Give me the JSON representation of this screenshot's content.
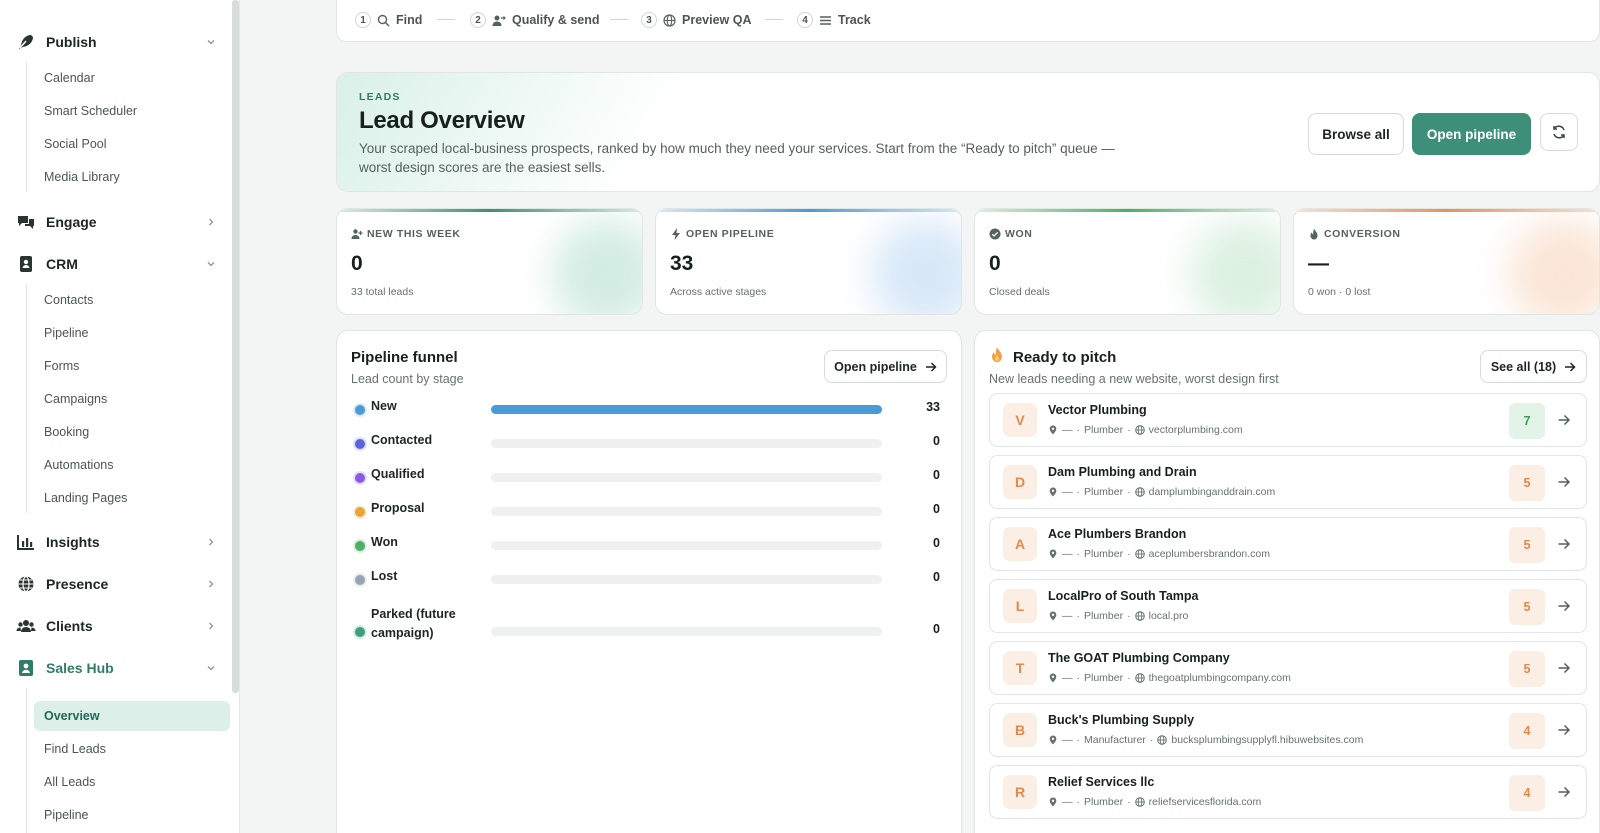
{
  "sidebar": {
    "groups": [
      {
        "label": "Publish",
        "icon": "feather-pen-icon",
        "expanded": true
      },
      {
        "label": "Engage",
        "icon": "chat-bubbles-icon",
        "expanded": false
      },
      {
        "label": "CRM",
        "icon": "contact-book-icon",
        "expanded": true
      },
      {
        "label": "Insights",
        "icon": "bar-chart-icon",
        "expanded": false
      },
      {
        "label": "Presence",
        "icon": "globe-icon",
        "expanded": false
      },
      {
        "label": "Clients",
        "icon": "users-icon",
        "expanded": false
      },
      {
        "label": "Sales Hub",
        "icon": "sales-contact-icon",
        "expanded": true
      }
    ],
    "publish_items": [
      "Calendar",
      "Smart Scheduler",
      "Social Pool",
      "Media Library"
    ],
    "crm_items": [
      "Contacts",
      "Pipeline",
      "Forms",
      "Campaigns",
      "Booking",
      "Automations",
      "Landing Pages"
    ],
    "sales_items": [
      "Overview",
      "Find Leads",
      "All Leads",
      "Pipeline"
    ],
    "active_item": "Overview"
  },
  "steps": [
    {
      "num": "1",
      "label": "Find",
      "icon": "search-icon"
    },
    {
      "num": "2",
      "label": "Qualify & send",
      "icon": "user-send-icon"
    },
    {
      "num": "3",
      "label": "Preview QA",
      "icon": "globe-icon"
    },
    {
      "num": "4",
      "label": "Track",
      "icon": "list-icon"
    }
  ],
  "hero": {
    "eyebrow": "LEADS",
    "title": "Lead Overview",
    "description": "Your scraped local-business prospects, ranked by how much they need your services. Start from the “Ready to pitch” queue — worst design scores are the easiest sells.",
    "browse_label": "Browse all",
    "open_label": "Open pipeline"
  },
  "stats": [
    {
      "label": "NEW THIS WEEK",
      "icon": "user-plus-icon",
      "value": "0",
      "sub": "33 total leads",
      "color": "#3d8f79"
    },
    {
      "label": "OPEN PIPELINE",
      "icon": "bolt-icon",
      "value": "33",
      "sub": "Across active stages",
      "color": "#4a9ad6"
    },
    {
      "label": "WON",
      "icon": "check-circle-icon",
      "value": "0",
      "sub": "Closed deals",
      "color": "#4caf63"
    },
    {
      "label": "CONVERSION",
      "icon": "flame-icon",
      "value": "—",
      "sub": "0 won · 0 lost",
      "color": "#e8915a"
    }
  ],
  "funnel": {
    "title": "Pipeline funnel",
    "subtitle": "Lead count by stage",
    "button_label": "Open pipeline",
    "stages": [
      {
        "name": "New",
        "count": 33,
        "color": "#4a9ad6"
      },
      {
        "name": "Contacted",
        "count": 0,
        "color": "#5b63d9"
      },
      {
        "name": "Qualified",
        "count": 0,
        "color": "#8a5be0"
      },
      {
        "name": "Proposal",
        "count": 0,
        "color": "#eba43a"
      },
      {
        "name": "Won",
        "count": 0,
        "color": "#4caf63"
      },
      {
        "name": "Lost",
        "count": 0,
        "color": "#98a4b3"
      },
      {
        "name": "Parked (future campaign)",
        "count": 0,
        "color": "#3d9f7d"
      }
    ]
  },
  "ready": {
    "title": "Ready to pitch",
    "subtitle": "New leads needing a new website, worst design first",
    "button_label": "See all (18)",
    "leads": [
      {
        "initial": "V",
        "name": "Vector Plumbing",
        "location": "—",
        "category": "Plumber",
        "site": "vectorplumbing.com",
        "score": "7"
      },
      {
        "initial": "D",
        "name": "Dam Plumbing and Drain",
        "location": "—",
        "category": "Plumber",
        "site": "damplumbinganddrain.com",
        "score": "5"
      },
      {
        "initial": "A",
        "name": "Ace Plumbers Brandon",
        "location": "—",
        "category": "Plumber",
        "site": "aceplumbersbrandon.com",
        "score": "5"
      },
      {
        "initial": "L",
        "name": "LocalPro of South Tampa",
        "location": "—",
        "category": "Plumber",
        "site": "local.pro",
        "score": "5"
      },
      {
        "initial": "T",
        "name": "The GOAT Plumbing Company",
        "location": "—",
        "category": "Plumber",
        "site": "thegoatplumbingcompany.com",
        "score": "5"
      },
      {
        "initial": "B",
        "name": "Buck's Plumbing Supply",
        "location": "—",
        "category": "Manufacturer",
        "site": "bucksplumbingsupplyfl.hibuwebsites.com",
        "score": "4"
      },
      {
        "initial": "R",
        "name": "Relief Services llc",
        "location": "—",
        "category": "Plumber",
        "site": "reliefservicesflorida.com",
        "score": "4"
      }
    ]
  }
}
